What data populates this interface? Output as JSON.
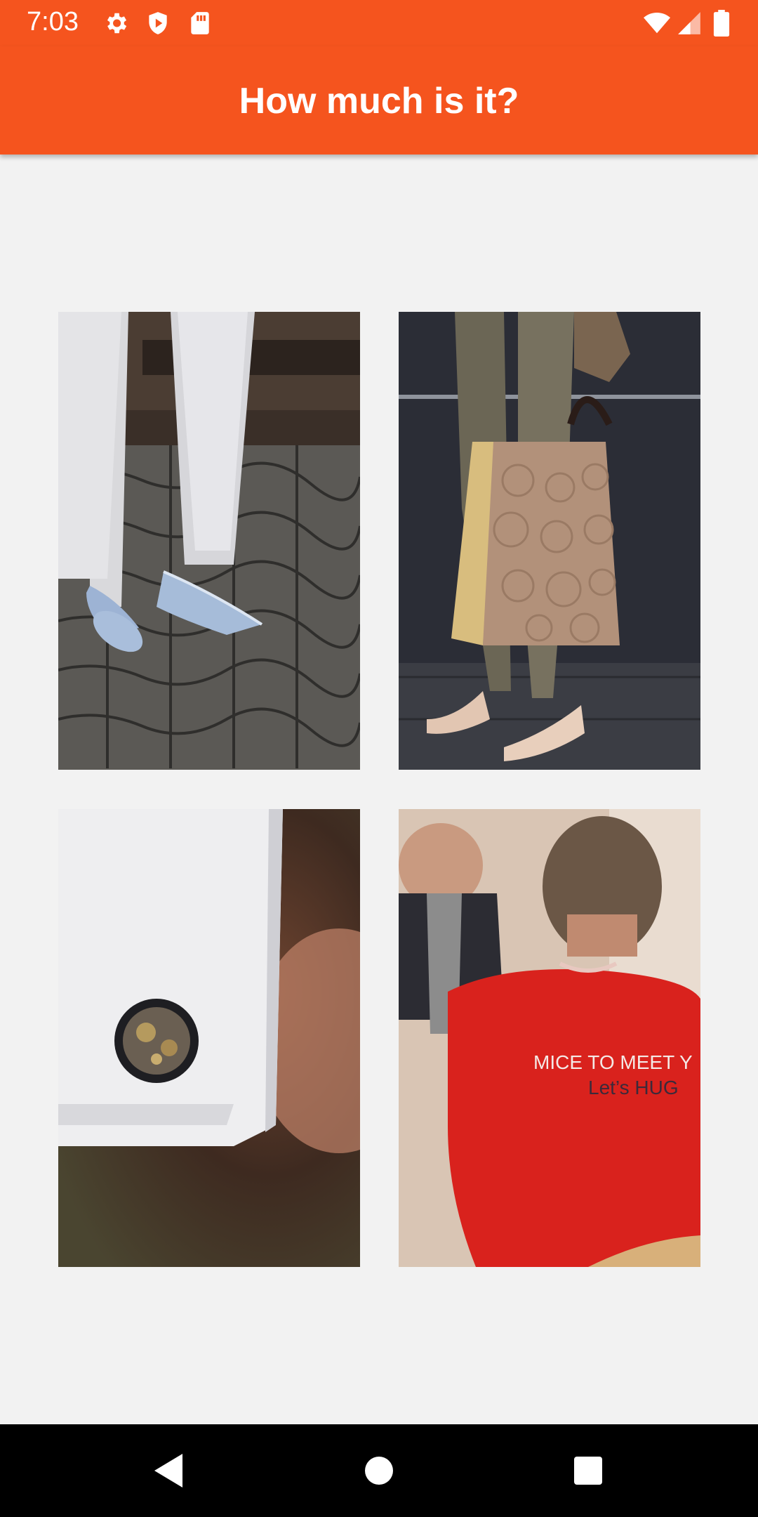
{
  "status_bar": {
    "time": "7:03",
    "left_icons": [
      "gear-icon",
      "shield-play-icon",
      "sd-card-icon"
    ],
    "right_icons": [
      "wifi-icon",
      "cell-signal-icon",
      "battery-icon"
    ]
  },
  "app_bar": {
    "title": "How much is it?"
  },
  "grid": {
    "items": [
      {
        "name": "shoes-photo",
        "subject": "pumps"
      },
      {
        "name": "handbag-photo",
        "subject": "handbag"
      },
      {
        "name": "cufflink-photo",
        "subject": "cufflink"
      },
      {
        "name": "sweatshirt-photo",
        "subject": "sweatshirt",
        "shirt_text_line1": "MICE TO MEET Y",
        "shirt_text_line2": "Let’s HUG"
      }
    ]
  },
  "colors": {
    "accent": "#f5541e",
    "background": "#f2f2f2",
    "nav_bar": "#000000"
  },
  "nav_bar": {
    "buttons": [
      "back-icon",
      "home-icon",
      "recents-icon"
    ]
  }
}
